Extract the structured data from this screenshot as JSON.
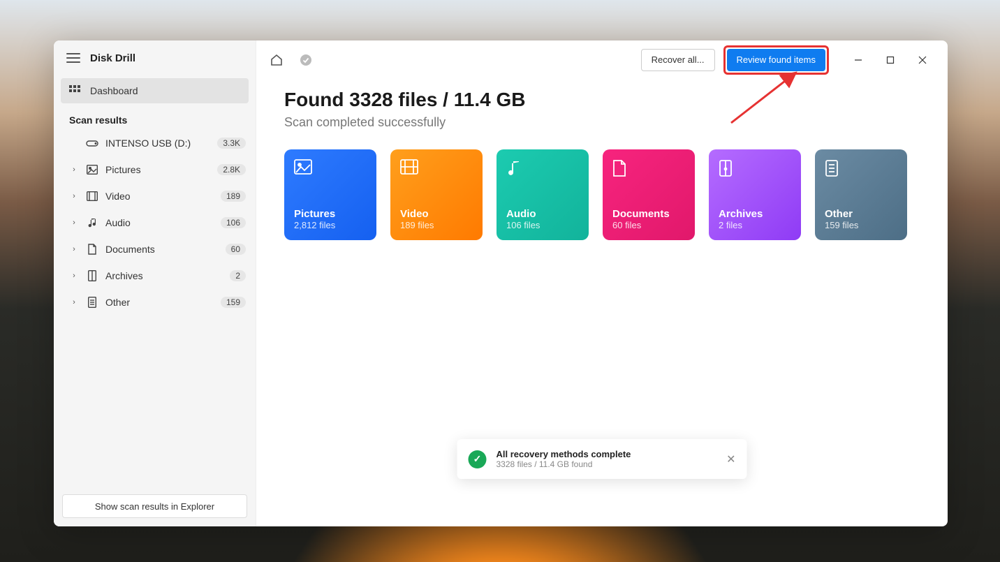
{
  "app": {
    "name": "Disk Drill"
  },
  "sidebar": {
    "nav": {
      "dashboard": "Dashboard"
    },
    "section_label": "Scan results",
    "drive": {
      "name": "INTENSO USB (D:)",
      "count": "3.3K"
    },
    "items": [
      {
        "label": "Pictures",
        "count": "2.8K"
      },
      {
        "label": "Video",
        "count": "189"
      },
      {
        "label": "Audio",
        "count": "106"
      },
      {
        "label": "Documents",
        "count": "60"
      },
      {
        "label": "Archives",
        "count": "2"
      },
      {
        "label": "Other",
        "count": "159"
      }
    ],
    "footer_button": "Show scan results in Explorer"
  },
  "topbar": {
    "recover_all": "Recover all...",
    "review": "Review found items"
  },
  "main": {
    "headline": "Found 3328 files / 11.4 GB",
    "subhead": "Scan completed successfully"
  },
  "cards": [
    {
      "title": "Pictures",
      "sub": "2,812 files"
    },
    {
      "title": "Video",
      "sub": "189 files"
    },
    {
      "title": "Audio",
      "sub": "106 files"
    },
    {
      "title": "Documents",
      "sub": "60 files"
    },
    {
      "title": "Archives",
      "sub": "2 files"
    },
    {
      "title": "Other",
      "sub": "159 files"
    }
  ],
  "toast": {
    "title": "All recovery methods complete",
    "sub": "3328 files / 11.4 GB found"
  }
}
